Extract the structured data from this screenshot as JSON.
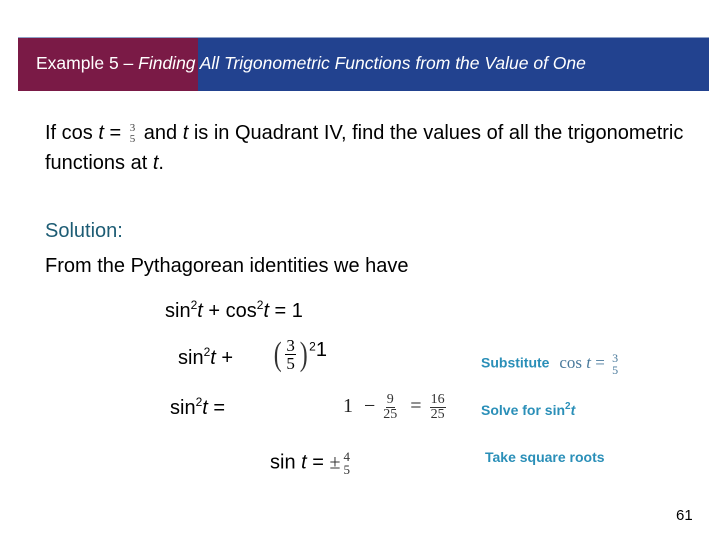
{
  "header": {
    "title_prefix": "Example 5 – ",
    "title_italic": "Finding All Trigonometric Functions from the Value of One",
    "colors": {
      "left_block": "#7a1a46",
      "bar": "#22428f",
      "text": "#ffffff"
    }
  },
  "problem": {
    "part1": "If cos ",
    "var_t": "t",
    "part2": " = ",
    "frac_num": "3",
    "frac_den": "5",
    "part3": " and ",
    "part4": " is in Quadrant IV, find the values of all the trigonometric functions at ",
    "part5": "."
  },
  "solution": {
    "label": "Solution:",
    "intro": "From the Pythagorean identities we have",
    "label_color": "#1d5c74"
  },
  "equations": {
    "identity": {
      "sin": "sin",
      "exp": "2",
      "t": "t",
      "plus_cos": " + cos",
      "equals": " = 1"
    },
    "substituted": {
      "sin": "sin",
      "exp": "2",
      "t": "t",
      "plus": " +",
      "num": "3",
      "den": "5",
      "paren_exp": "2",
      "rhs": "1"
    },
    "solved": {
      "sin": "sin",
      "exp": "2",
      "t": "t",
      "equals": " =",
      "one": "1",
      "minus": "−",
      "num1": "9",
      "den1": "25",
      "eq": "=",
      "num2": "16",
      "den2": "25"
    },
    "root": {
      "sin": "sin ",
      "t": "t",
      "equals": " = ",
      "pm": "±",
      "num": "4",
      "den": "5"
    }
  },
  "notes": {
    "substitute": {
      "label": "Substitute",
      "math_cos": "cos ",
      "math_t": "t",
      "math_eq": " = ",
      "num": "3",
      "den": "5"
    },
    "solve": {
      "label": "Solve for sin",
      "exp": "2",
      "t": "t"
    },
    "roots": {
      "label": "Take square roots"
    },
    "color": "#2a8fb8"
  },
  "page_number": "61"
}
